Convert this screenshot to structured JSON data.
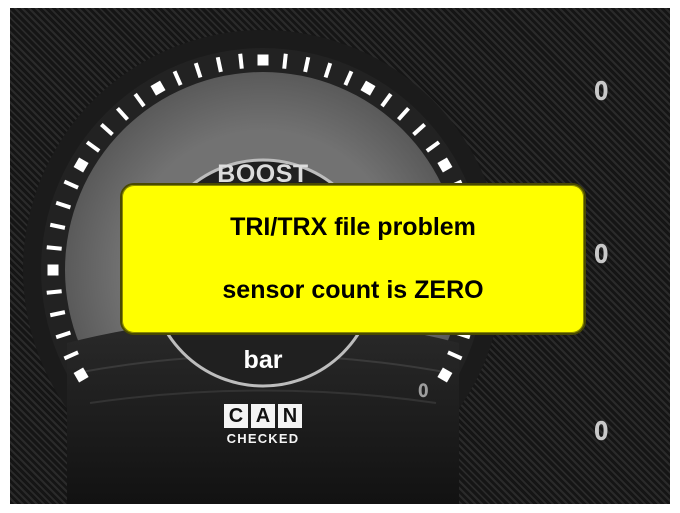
{
  "gauge": {
    "label": "BOOST",
    "unit": "bar",
    "value_small": "0"
  },
  "readouts": [
    "0",
    "0",
    "0"
  ],
  "logo": {
    "letters": [
      "C",
      "A",
      "N"
    ],
    "subtitle": "CHECKED"
  },
  "alert": {
    "line1": "TRI/TRX file problem",
    "line2": "sensor count is ZERO"
  },
  "colors": {
    "alert_bg": "#ffff00",
    "background": "#1d1d1d",
    "gauge_ring": "#6a6a6a",
    "tick": "#ffffff"
  }
}
